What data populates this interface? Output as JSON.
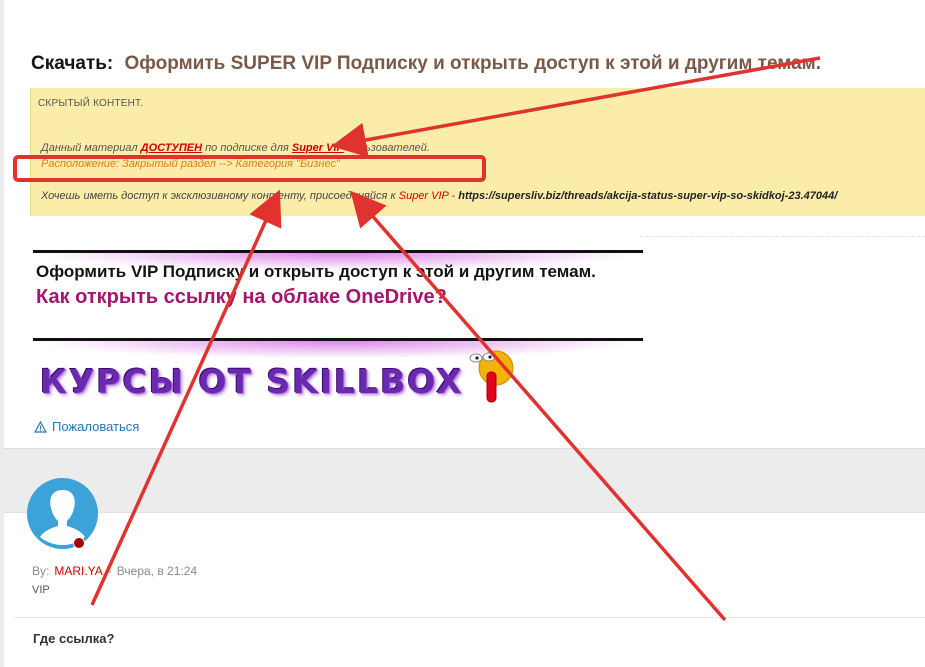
{
  "post": {
    "download_label": "Скачать:",
    "download_link": "Оформить SUPER VIP Подписку и открыть доступ к этой и другим темам.",
    "hidden": {
      "title": "СКРЫТЫЙ КОНТЕНТ.",
      "line1_pre": "Данный материал ",
      "line1_available": "ДОСТУПЕН",
      "line1_mid": " по подписке для ",
      "line1_vip": "Super VIP",
      "line1_post": " пользователей.",
      "location": "Расположение: Закрытый раздел --> Категория \"Бизнес\"",
      "line3_pre": "Хочешь иметь доступ к эксклюзивному контенту, присоединяйся к ",
      "line3_vip": "Super VIP",
      "line3_dash": " - ",
      "line3_url": "https://supersliv.biz/threads/akcija-status-super-vip-so-skidkoj-23.47044/"
    },
    "vip_promo": "Оформить VIP Подписку и открыть доступ к этой и другим темам.",
    "onedrive_link": "Как открыть ссылку на облаке OneDrive?",
    "banner_text": "КУРСЫ ОТ SKILLBOX",
    "report_label": "Пожаловаться",
    "report_icon": "warning-triangle-icon"
  },
  "reply": {
    "avatar_icon": "default-avatar-icon",
    "by_label": "By:",
    "username": "MARI.YA",
    "separator": "-",
    "time": "Вчера, в 21:24",
    "role": "VIP",
    "message": "Где ссылка?"
  },
  "colors": {
    "hidden_bg": "#fbeda9",
    "accent_red": "#d40000",
    "annotation_red": "#e0332f",
    "link_blue": "#2577b1",
    "onedrive_magenta": "#a4166d",
    "avatar_blue": "#3ba3d8"
  }
}
